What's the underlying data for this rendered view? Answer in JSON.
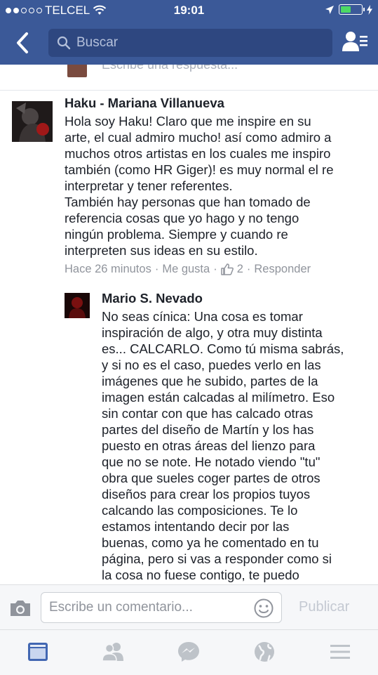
{
  "status_bar": {
    "carrier": "TELCEL",
    "time": "19:01"
  },
  "nav": {
    "search_placeholder": "Buscar"
  },
  "previous_reply": {
    "placeholder": "Escribe una respuesta..."
  },
  "comments": [
    {
      "author": "Haku - Mariana Villanueva",
      "text": "Hola soy Haku! Claro que me inspire en su\narte, el cual admiro mucho! así como admiro a\nmuchos otros artistas en los cuales me inspiro\ntambién (como HR Giger)! es muy normal el re\ninterpretar y tener referentes.\nTambién hay personas que han tomado de\nreferencia cosas que yo hago y no tengo\nningún problema. Siempre y cuando re\ninterpreten sus ideas en su estilo.",
      "time": "Hace 26 minutos",
      "like_label": "Me gusta",
      "like_count": "2",
      "reply_label": "Responder"
    },
    {
      "author": "Mario S. Nevado",
      "text": "No seas cínica: Una cosa es tomar\ninspiración de algo, y otra muy distinta\nes... CALCARLO. Como tú misma sabrás,\ny si no es el caso, puedes verlo en las\nimágenes que he subido, partes de la\nimagen están calcadas al milímetro. Eso\nsin contar con que has calcado otras\npartes del diseño de Martín y los has\npuesto en otras áreas del lienzo para\nque no se note. He notado viendo \"tu\"\nobra que sueles coger partes de otros\ndiseños para crear los propios tuyos\ncalcando las composiciones. Te lo\nestamos intentando decir por las\nbuenas, como ya he comentado en tu\npágina, pero si vas a responder como si\nla cosa no fuese contigo, te puedo"
    }
  ],
  "composer": {
    "placeholder": "Escribe un comentario...",
    "publish_label": "Publicar"
  },
  "colors": {
    "brand": "#3b5998",
    "meta_text": "#90949c",
    "tab_active": "#4267b2",
    "tab_inactive": "#bec3c9"
  },
  "tabs": [
    {
      "icon": "news-feed-icon",
      "active": true
    },
    {
      "icon": "friends-icon",
      "active": false
    },
    {
      "icon": "messenger-icon",
      "active": false
    },
    {
      "icon": "globe-icon",
      "active": false
    },
    {
      "icon": "menu-icon",
      "active": false
    }
  ]
}
